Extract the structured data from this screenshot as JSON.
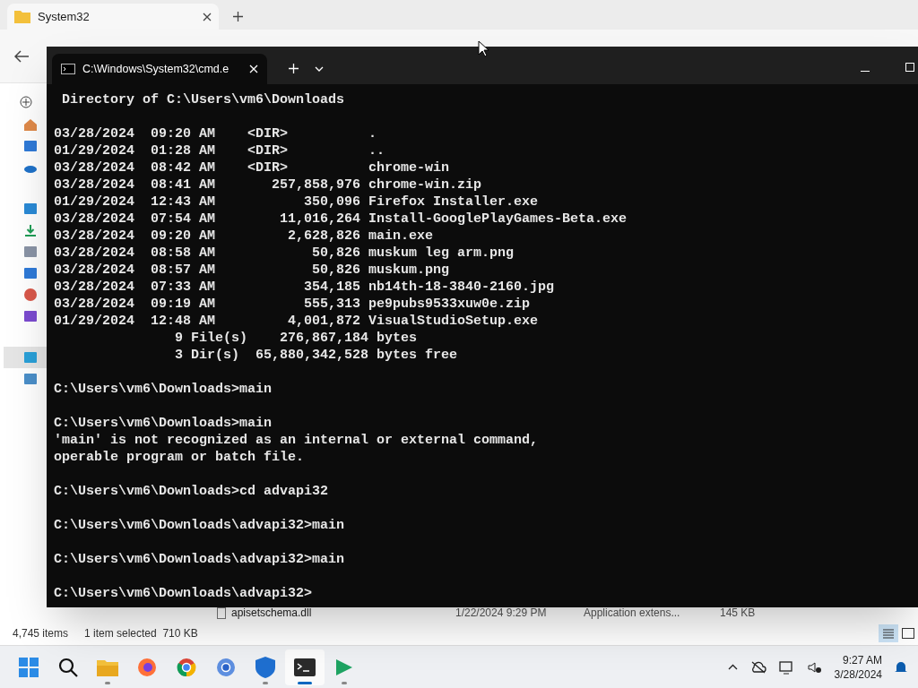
{
  "explorer": {
    "tab_title": "System32",
    "sidebar": [
      {
        "selected": false
      },
      {
        "selected": false
      },
      {
        "selected": false
      },
      {
        "selected": false
      },
      {
        "selected": false
      },
      {
        "selected": false
      },
      {
        "selected": false
      },
      {
        "selected": false
      },
      {
        "selected": false
      },
      {
        "selected": true
      },
      {
        "selected": false
      }
    ],
    "file_row": {
      "name": "apisetschema.dll",
      "date": "1/22/2024 9:29 PM",
      "type": "Application extens...",
      "size": "145 KB"
    },
    "status_bar": {
      "count": "4,745 items",
      "selection": "1 item selected  710 KB"
    }
  },
  "terminal": {
    "tab_title": "C:\\Windows\\System32\\cmd.e",
    "blocks": [
      [
        " Directory of C:\\Users\\vm6\\Downloads"
      ],
      [
        "03/28/2024  09:20 AM    <DIR>          .",
        "01/29/2024  01:28 AM    <DIR>          ..",
        "03/28/2024  08:42 AM    <DIR>          chrome-win",
        "03/28/2024  08:41 AM       257,858,976 chrome-win.zip",
        "01/29/2024  12:43 AM           350,096 Firefox Installer.exe",
        "03/28/2024  07:54 AM        11,016,264 Install-GooglePlayGames-Beta.exe",
        "03/28/2024  09:20 AM         2,628,826 main.exe",
        "03/28/2024  08:58 AM            50,826 muskum leg arm.png",
        "03/28/2024  08:57 AM            50,826 muskum.png",
        "03/28/2024  07:33 AM           354,185 nb14th-18-3840-2160.jpg",
        "03/28/2024  09:19 AM           555,313 pe9pubs9533xuw0e.zip",
        "01/29/2024  12:48 AM         4,001,872 VisualStudioSetup.exe",
        "               9 File(s)    276,867,184 bytes",
        "               3 Dir(s)  65,880,342,528 bytes free"
      ],
      [
        "C:\\Users\\vm6\\Downloads>main"
      ],
      [
        "C:\\Users\\vm6\\Downloads>main",
        "'main' is not recognized as an internal or external command,",
        "operable program or batch file."
      ],
      [
        "C:\\Users\\vm6\\Downloads>cd advapi32"
      ],
      [
        "C:\\Users\\vm6\\Downloads\\advapi32>main"
      ],
      [
        "C:\\Users\\vm6\\Downloads\\advapi32>main"
      ],
      [
        "C:\\Users\\vm6\\Downloads\\advapi32>"
      ]
    ]
  },
  "taskbar": {
    "apps": [
      {
        "active": false,
        "running": false
      },
      {
        "active": false,
        "running": false
      },
      {
        "active": false,
        "running": true
      },
      {
        "active": false,
        "running": false
      },
      {
        "active": false,
        "running": false
      },
      {
        "active": false,
        "running": false
      },
      {
        "active": false,
        "running": true
      },
      {
        "active": true,
        "running": true
      },
      {
        "active": false,
        "running": true
      }
    ],
    "time": "9:27 AM",
    "date": "3/28/2024"
  }
}
